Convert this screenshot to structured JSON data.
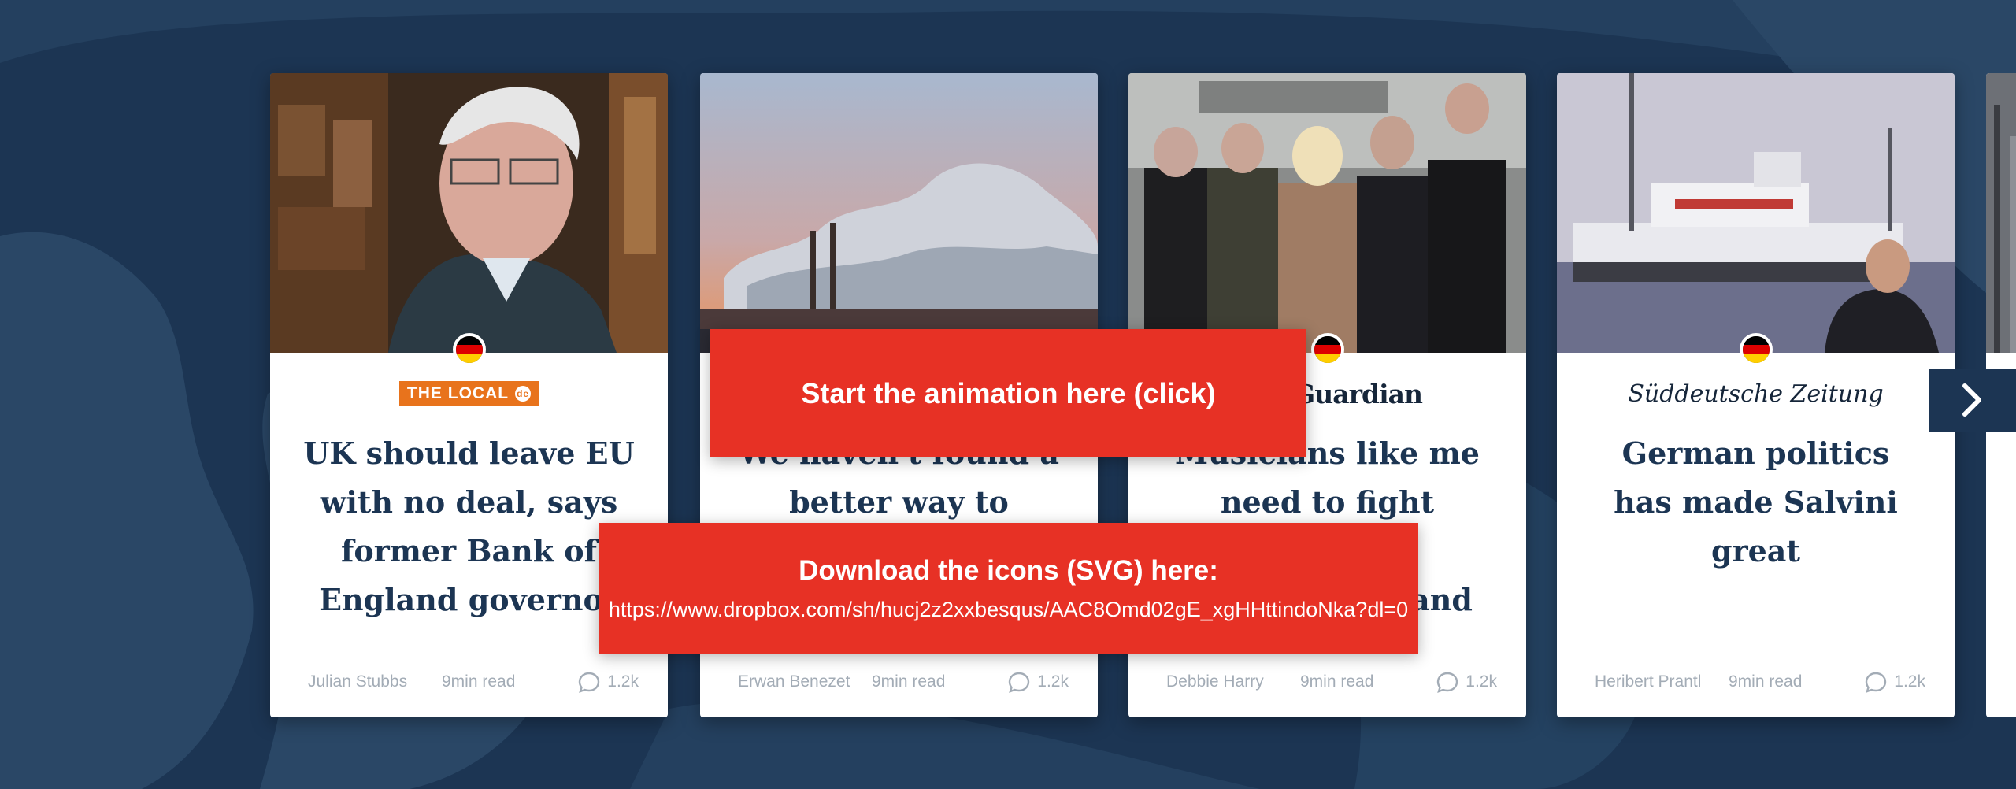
{
  "articles": [
    {
      "publisher": "THE LOCAL",
      "publisher_badge": "de",
      "headline": "UK should leave EU with no deal, says former Bank of England governor",
      "author": "Julian Stubbs",
      "read_time": "9min read",
      "comments": "1.2k",
      "flag": "germany-flag"
    },
    {
      "publisher": "",
      "headline": "We haven't found a better way to",
      "author": "Erwan Benezet",
      "read_time": "9min read",
      "comments": "1.2k",
      "flag": "germany-flag"
    },
    {
      "publisher": "The Guardian",
      "headline": "Musicians like me need to fight against governments and",
      "author": "Debbie Harry",
      "read_time": "9min read",
      "comments": "1.2k",
      "flag": "germany-flag"
    },
    {
      "publisher": "Süddeutsche Zeitung",
      "headline": "German politics has made Salvini great",
      "author": "Heribert Prantl",
      "read_time": "9min read",
      "comments": "1.2k",
      "flag": "germany-flag"
    }
  ],
  "overlays": {
    "start_label": "Start the animation here (click)",
    "download_title": "Download the icons (SVG) here:",
    "download_url": "https://www.dropbox.com/sh/hucj2z2xxbesqus/AAC8Omd02gE_xgHHttindoNka?dl=0"
  },
  "colors": {
    "background": "#1c3553",
    "overlay": "#e73125",
    "headline": "#1c3553",
    "meta": "#a3acb6"
  },
  "icons": {
    "next": "chevron-right-icon",
    "comments": "speech-bubble-icon"
  }
}
